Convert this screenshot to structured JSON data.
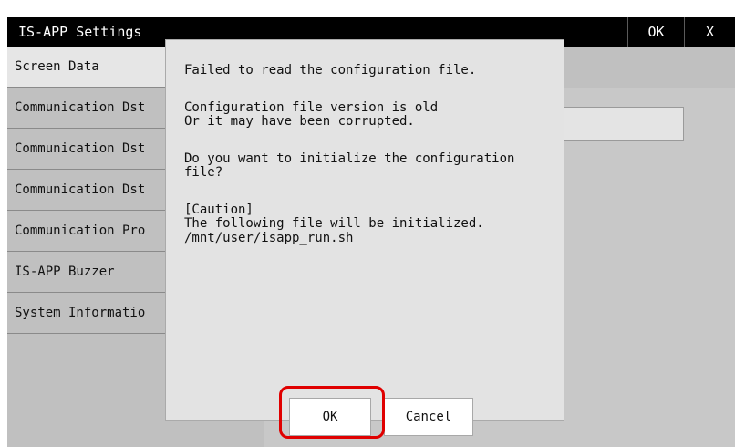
{
  "window": {
    "title": "IS-APP Settings",
    "ok_label": "OK",
    "close_label": "X"
  },
  "sidebar": {
    "items": [
      {
        "label": "Screen Data"
      },
      {
        "label": "Communication Dst"
      },
      {
        "label": "Communication Dst"
      },
      {
        "label": "Communication Dst"
      },
      {
        "label": "Communication Pro"
      },
      {
        "label": "IS-APP Buzzer"
      },
      {
        "label": "System Informatio"
      }
    ]
  },
  "dialog": {
    "line1": "Failed to read the configuration file.",
    "line2": "Configuration file version is old",
    "line3": "Or it may have been corrupted.",
    "line4": "Do you want to initialize the configuration",
    "line5": "file?",
    "line6": "[Caution]",
    "line7": "The following file will be initialized.",
    "line8": "/mnt/user/isapp_run.sh",
    "ok_label": "OK",
    "cancel_label": "Cancel"
  },
  "colors": {
    "highlight": "#e00000",
    "titlebar": "#000000",
    "background": "#c0c0c0"
  }
}
